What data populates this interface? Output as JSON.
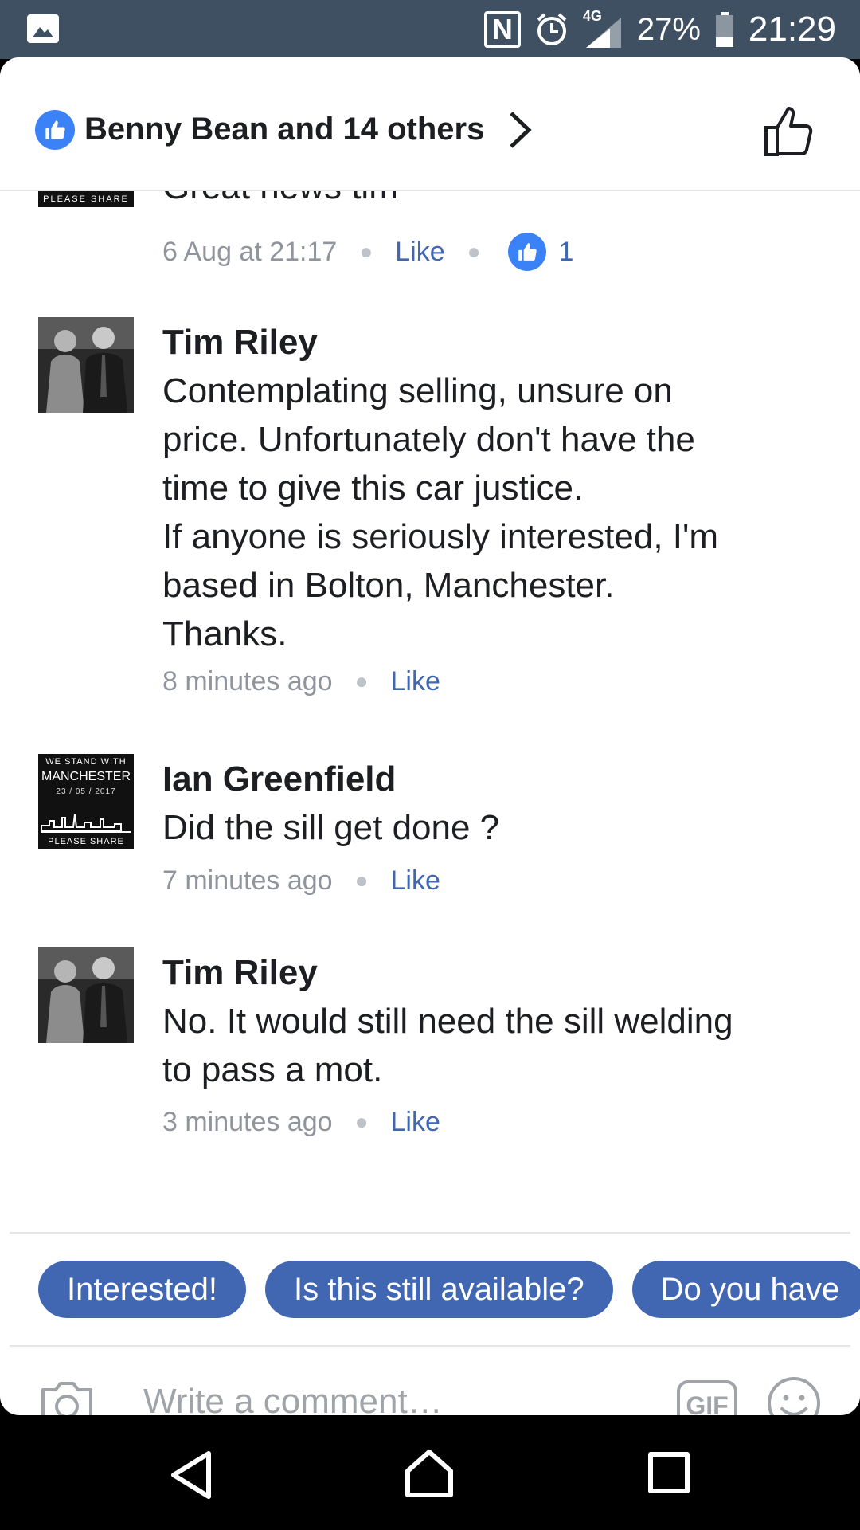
{
  "status_bar": {
    "nfc": "N",
    "network": "4G",
    "battery": "27%",
    "time": "21:29"
  },
  "header": {
    "likers_text": "Benny Bean and 14 others"
  },
  "partial_comment": {
    "text_cut": "Great news tim",
    "avatar_caption": "PLEASE SHARE",
    "time": "6 Aug at 21:17",
    "like_label": "Like",
    "reaction_count": "1"
  },
  "comments": [
    {
      "name": "Tim Riley",
      "lines": [
        "Contemplating selling, unsure on",
        "price. Unfortunately don't have the",
        "time to give this car justice.",
        "If anyone is seriously interested, I'm",
        "based in Bolton, Manchester.",
        "Thanks."
      ],
      "time": "8 minutes ago",
      "like_label": "Like"
    },
    {
      "name": "Ian Greenfield",
      "lines": [
        "Did the sill get done ?"
      ],
      "time": "7 minutes ago",
      "like_label": "Like",
      "avatar": {
        "line1": "WE STAND WITH",
        "line2": "MANCHESTER",
        "line3": "23 / 05 / 2017",
        "line4": "PLEASE SHARE"
      }
    },
    {
      "name": "Tim Riley",
      "lines": [
        "No. It would still need the sill welding",
        "to pass a mot."
      ],
      "time": "3 minutes ago",
      "like_label": "Like"
    }
  ],
  "quick_replies": [
    "Interested!",
    "Is this still available?",
    "Do you have"
  ],
  "composer": {
    "placeholder": "Write a comment…",
    "gif_label": "GIF"
  },
  "colors": {
    "status_bar": "#3f5063",
    "accent": "#4267b2",
    "reaction_blue": "#3b82f6"
  }
}
